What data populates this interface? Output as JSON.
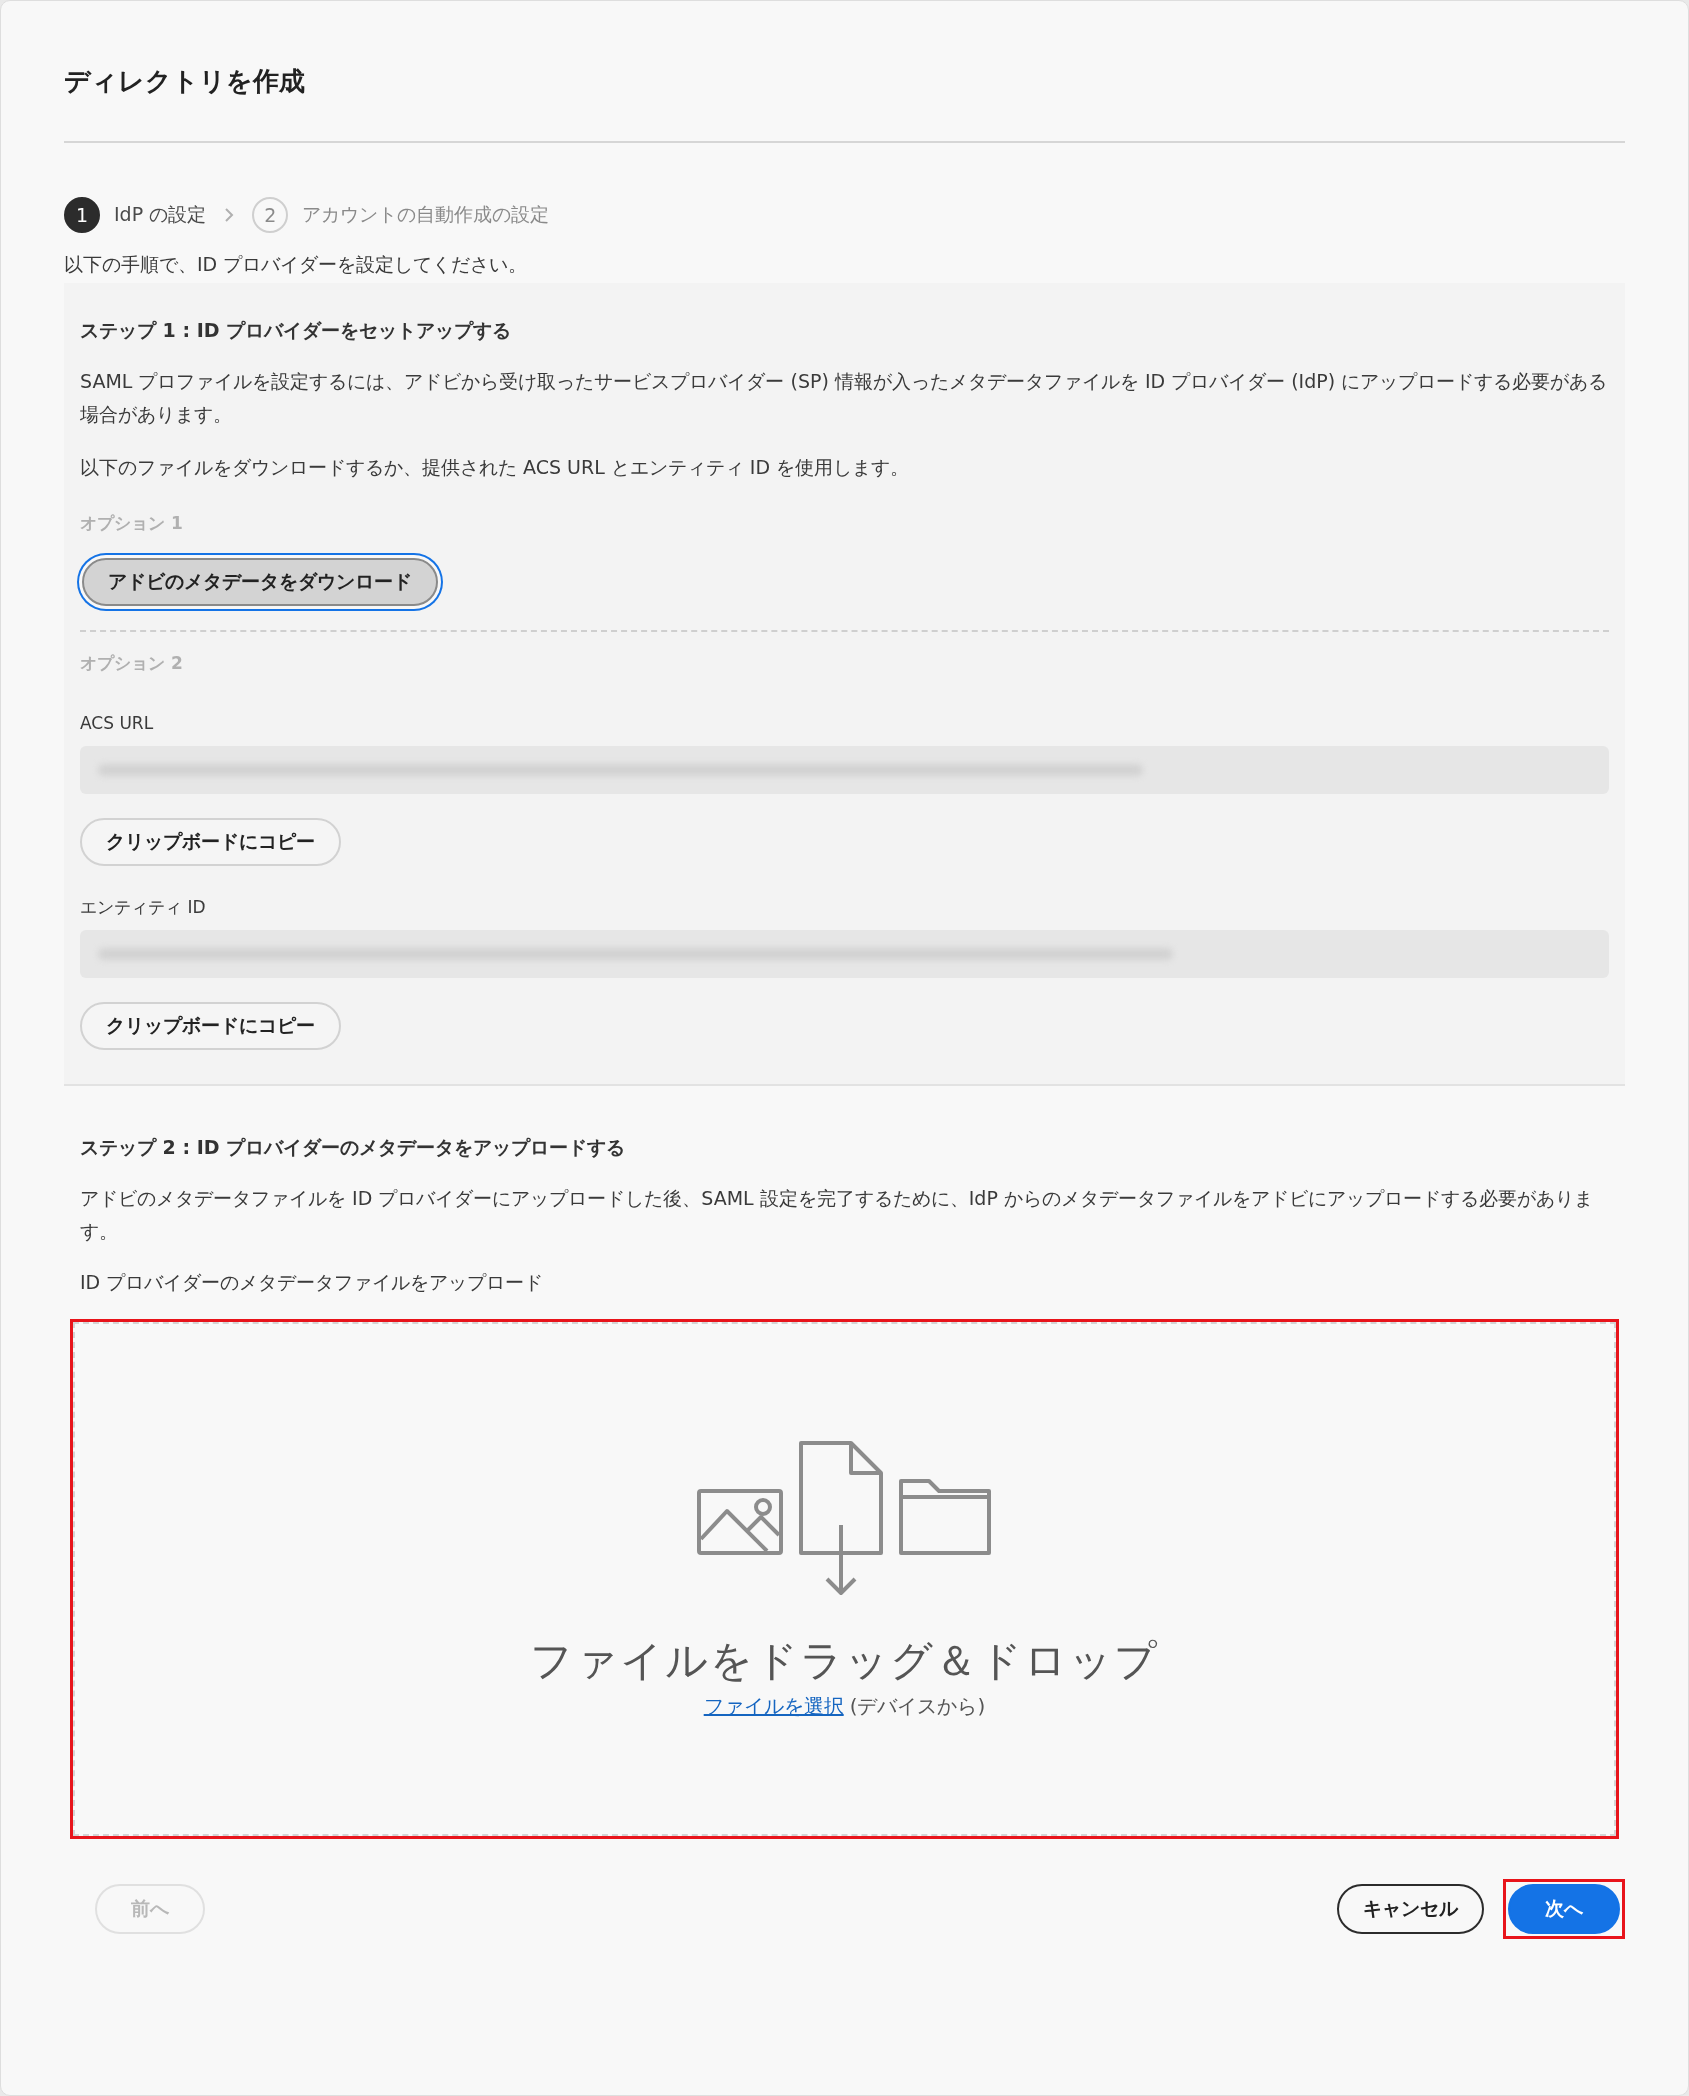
{
  "dialog": {
    "title": "ディレクトリを作成"
  },
  "stepper": [
    {
      "number": "1",
      "label": "IdP の設定",
      "selected": true
    },
    {
      "number": "2",
      "label": "アカウントの自動作成の設定",
      "selected": false
    }
  ],
  "intro": "以下の手順で、ID プロバイダーを設定してください。",
  "step1": {
    "heading": "ステップ 1 : ID プロバイダーをセットアップする",
    "paragraphs": [
      "SAML プロファイルを設定するには、アドビから受け取ったサービスプロバイダー (SP) 情報が入ったメタデータファイルを ID プロバイダー (IdP) にアップロードする必要がある場合があります。",
      "以下のファイルをダウンロードするか、提供された ACS URL とエンティティ ID を使用します。"
    ],
    "option1": {
      "label": "オプション 1",
      "button": {
        "label": "アドビのメタデータをダウンロード",
        "focused": true
      }
    },
    "option2": {
      "label": "オプション 2",
      "fields": [
        {
          "label": "ACS URL",
          "button": "クリップボードにコピー"
        },
        {
          "label": "エンティティ ID",
          "button": "クリップボードにコピー"
        }
      ]
    }
  },
  "step2": {
    "heading": "ステップ 2 : ID プロバイダーのメタデータをアップロードする",
    "paragraph": "アドビのメタデータファイルを ID プロバイダーにアップロードした後、SAML 設定を完了するために、IdP からのメタデータファイルをアドビにアップロードする必要があります。",
    "upload_label": "ID プロバイダーのメタデータファイルをアップロード",
    "dropzone": {
      "title": "ファイルをドラッグ＆ドロップ",
      "link": "ファイルを選択",
      "hint": "(デバイスから)",
      "highlighted": true
    }
  },
  "footer": {
    "buttons": [
      {
        "label": "前へ",
        "kind": "secondary",
        "disabled": true,
        "highlighted": false
      },
      {
        "label": "キャンセル",
        "kind": "secondary",
        "disabled": false,
        "highlighted": false
      },
      {
        "label": "次へ",
        "kind": "primary",
        "disabled": false,
        "highlighted": true
      }
    ]
  }
}
